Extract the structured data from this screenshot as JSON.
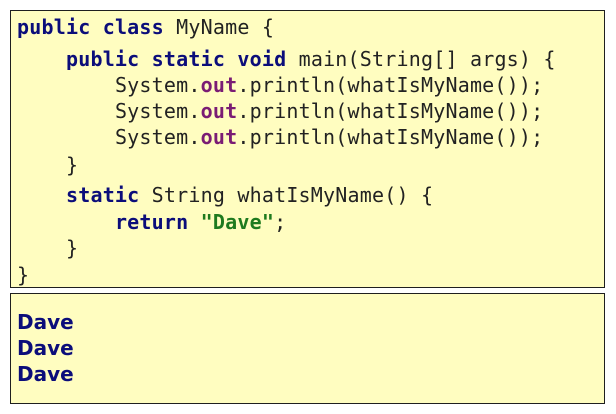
{
  "code": {
    "line1": {
      "kw1": "public",
      "kw2": "class",
      "rest": " MyName {"
    },
    "line2": {
      "indent": "    ",
      "kw1": "public",
      "kw2": "static",
      "kw3": "void",
      "rest": " main(String[] args) {"
    },
    "print_lines": [
      {
        "indent": "        ",
        "prefix": "System.",
        "field": "out",
        "suffix": ".println(whatIsMyName());"
      },
      {
        "indent": "        ",
        "prefix": "System.",
        "field": "out",
        "suffix": ".println(whatIsMyName());"
      },
      {
        "indent": "        ",
        "prefix": "System.",
        "field": "out",
        "suffix": ".println(whatIsMyName());"
      }
    ],
    "close_main": "    }",
    "line7": {
      "indent": "    ",
      "kw1": "static",
      "rest": " String whatIsMyName() {"
    },
    "line8": {
      "indent": "        ",
      "kw1": "return",
      "str": "\"Dave\"",
      "rest": ";"
    },
    "close_method": "    }",
    "close_class": "}"
  },
  "output": {
    "lines": [
      "Dave",
      "Dave",
      "Dave"
    ]
  }
}
